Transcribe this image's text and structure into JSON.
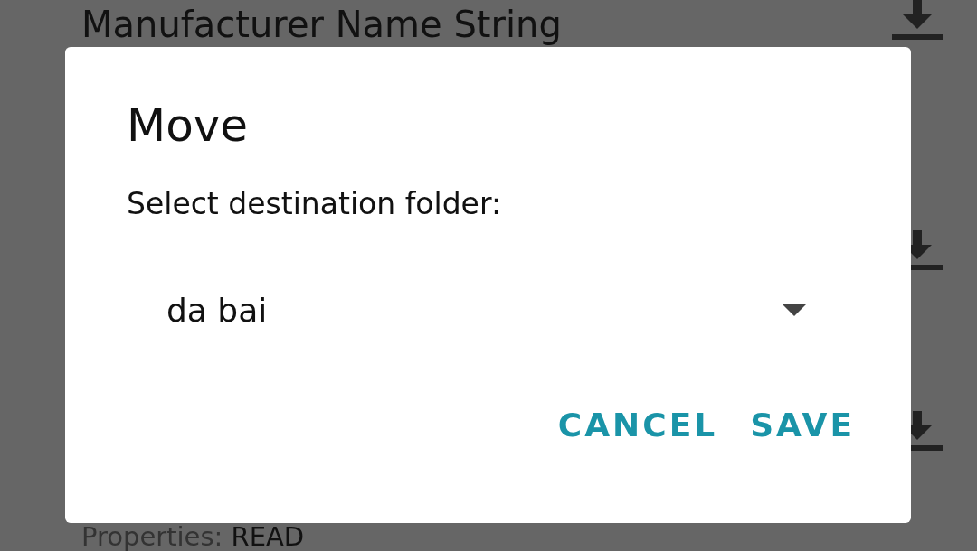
{
  "background": {
    "title": "Manufacturer Name String",
    "properties_label": "Properties:",
    "properties_value": "READ"
  },
  "dialog": {
    "title": "Move",
    "label": "Select destination folder:",
    "dropdown": {
      "value": "da bai"
    },
    "buttons": [
      "CANCEL",
      "SAVE"
    ]
  }
}
